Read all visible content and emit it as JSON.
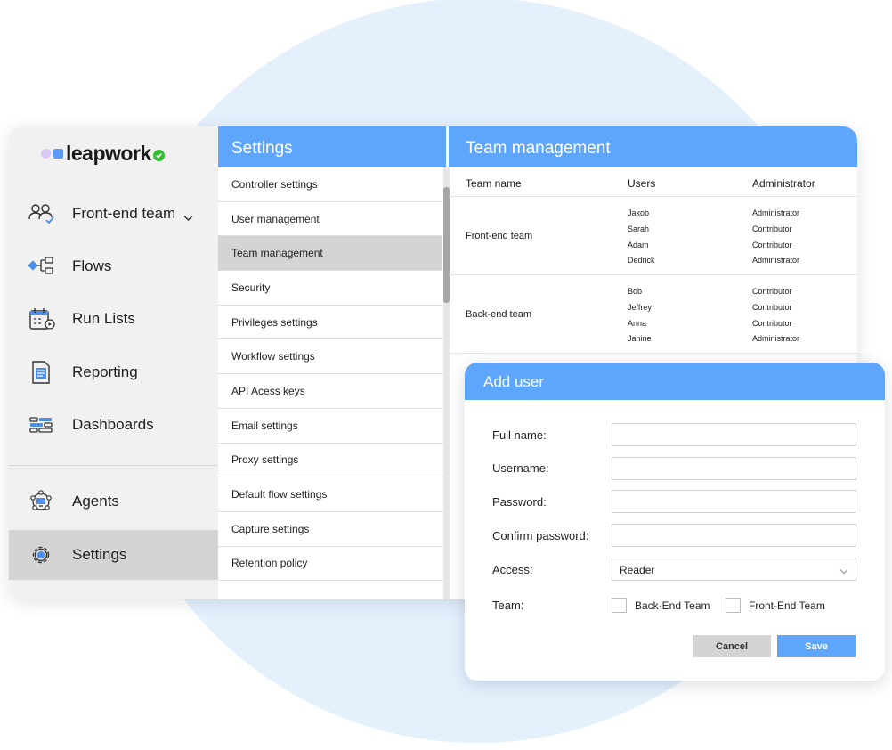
{
  "brand": {
    "name": "leapwork"
  },
  "sidebar": {
    "items": [
      {
        "label": "Front-end team",
        "icon": "team-icon"
      },
      {
        "label": "Flows",
        "icon": "flows-icon"
      },
      {
        "label": "Run Lists",
        "icon": "calendar-icon"
      },
      {
        "label": "Reporting",
        "icon": "report-icon"
      },
      {
        "label": "Dashboards",
        "icon": "dashboard-icon"
      },
      {
        "label": "Agents",
        "icon": "agents-icon"
      },
      {
        "label": "Settings",
        "icon": "gear-icon"
      }
    ],
    "active": "Settings"
  },
  "settings": {
    "title": "Settings",
    "items": [
      "Controller settings",
      "User management",
      "Team management",
      "Security",
      "Privileges settings",
      "Workflow settings",
      "API Acess keys",
      "Email settings",
      "Proxy settings",
      "Default flow settings",
      "Capture settings",
      "Retention policy"
    ],
    "active": "Team management"
  },
  "team": {
    "title": "Team management",
    "columns": [
      "Team name",
      "Users",
      "Administrator"
    ],
    "rows": [
      {
        "name": "Front-end team",
        "users": [
          "Jakob",
          "Sarah",
          "Adam",
          "Dedrick"
        ],
        "roles": [
          "Administrator",
          "Contributor",
          "Contributor",
          "Administrator"
        ]
      },
      {
        "name": "Back-end team",
        "users": [
          "Bob",
          "Jeffrey",
          "Anna",
          "Janine"
        ],
        "roles": [
          "Contributor",
          "Contributor",
          "Contributor",
          "Administrator"
        ]
      }
    ]
  },
  "dialog": {
    "title": "Add user",
    "labels": {
      "full_name": "Full name:",
      "username": "Username:",
      "password": "Password:",
      "confirm_password": "Confirm password:",
      "access": "Access:",
      "team": "Team:"
    },
    "values": {
      "full_name": "",
      "username": "",
      "password": "",
      "confirm_password": ""
    },
    "access_selected": "Reader",
    "team_options": [
      {
        "label": "Back-End Team",
        "checked": false
      },
      {
        "label": "Front-End Team",
        "checked": false
      }
    ],
    "cancel_label": "Cancel",
    "save_label": "Save"
  },
  "colors": {
    "accent": "#5ea6fb",
    "sidebar_bg": "#f1f1f1",
    "active_bg": "#d4d4d4",
    "background_circle": "#e4f0fc",
    "brand_check": "#2fc12f"
  }
}
